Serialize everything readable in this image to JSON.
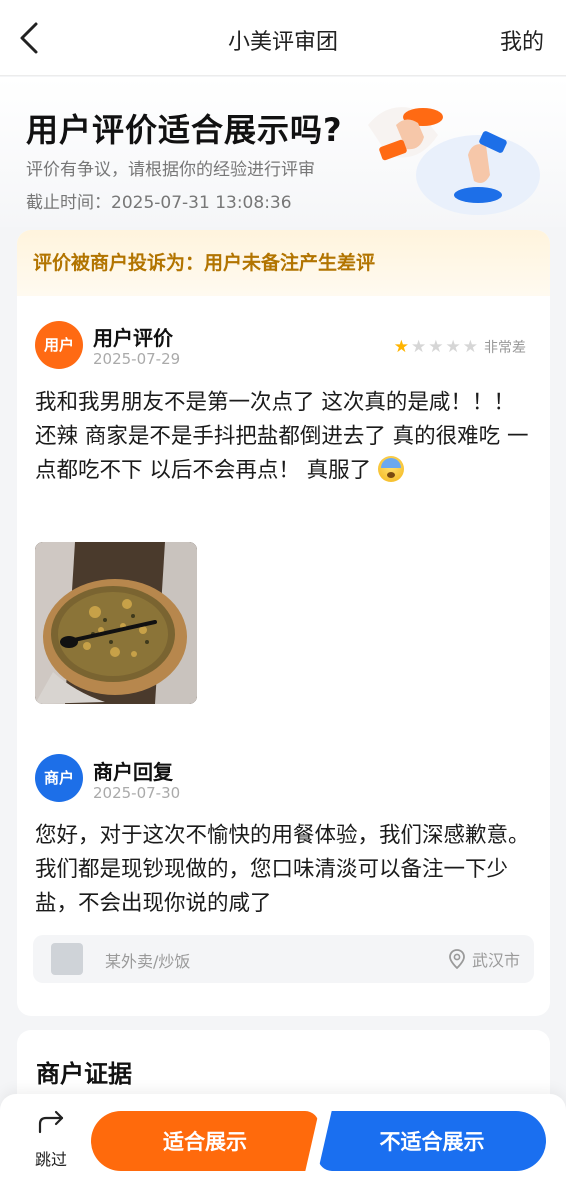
{
  "nav": {
    "title": "小美评审团",
    "right_label": "我的"
  },
  "hero": {
    "title": "用户评价适合展示吗?",
    "subtitle": "评价有争议，请根据你的经验进行评审",
    "deadline": "截止时间：2025-07-31 13:08:36"
  },
  "complaint": {
    "text": "评价被商户投诉为：用户未备注产生差评"
  },
  "user_review": {
    "avatar_label": "用户",
    "author": "用户评价",
    "date": "2025-07-29",
    "rating": 1,
    "rating_max": 5,
    "rating_text": "非常差",
    "text": "我和我男朋友不是第一次点了 这次真的是咸！！！ 还辣 商家是不是手抖把盐都倒进去了 真的很难吃 一点都吃不下 以后不会再点！ 真服了"
  },
  "merchant_reply": {
    "avatar_label": "商户",
    "author": "商户回复",
    "date": "2025-07-30",
    "text": "您好，对于这次不愉快的用餐体验，我们深感歉意。我们都是现钞现做的，您口味清淡可以备注一下少盐，不会出现你说的咸了"
  },
  "meta": {
    "shop": "某外卖/炒饭",
    "location": "武汉市"
  },
  "evidence": {
    "title": "商户证据"
  },
  "actions": {
    "skip_label": "跳过",
    "ok_label": "适合展示",
    "no_label": "不适合展示"
  },
  "colors": {
    "accent_orange": "#ff6a0c",
    "accent_blue": "#1a6ff0",
    "warning_text": "#b27400"
  }
}
